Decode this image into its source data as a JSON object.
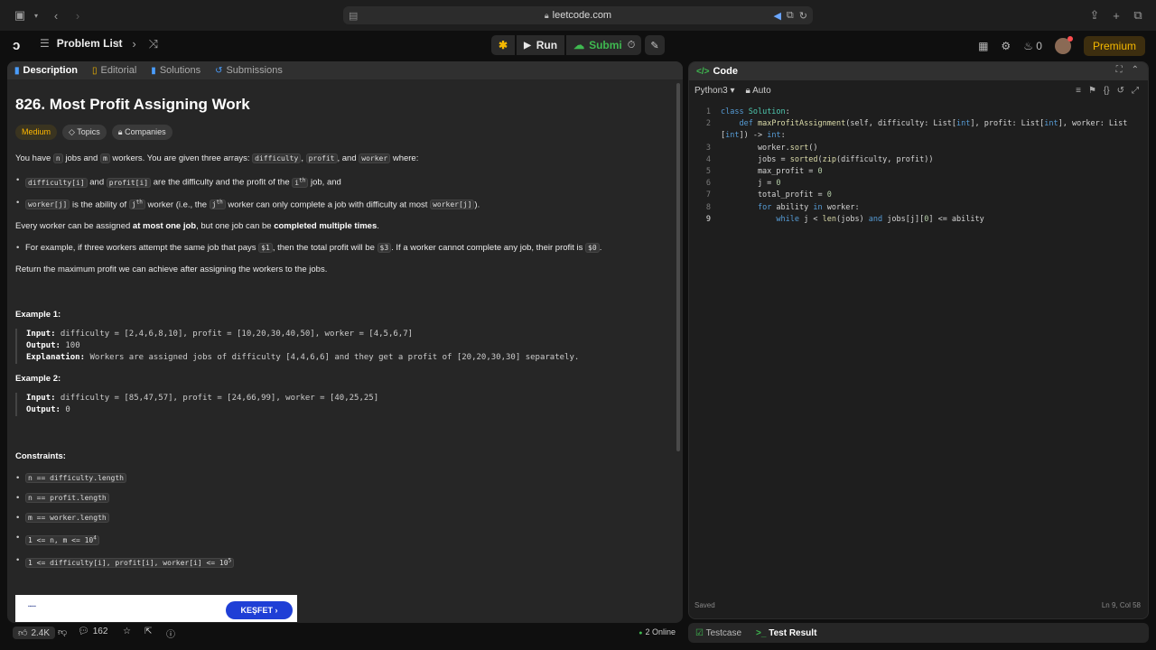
{
  "browser": {
    "url": "leetcode.com"
  },
  "nav": {
    "problem_list": "Problem List",
    "run": "Run",
    "submit": "Submit",
    "streak": "0",
    "premium": "Premium"
  },
  "left": {
    "tabs": [
      "Description",
      "Editorial",
      "Solutions",
      "Submissions"
    ],
    "title": "826. Most Profit Assigning Work",
    "pills": [
      "Medium",
      "Topics",
      "Companies"
    ],
    "intro": {
      "p1": "You have ",
      "c_n": "n",
      "p2": " jobs and ",
      "c_m": "m",
      "p3": " workers. You are given three arrays: ",
      "c_d": "difficulty",
      "c_p": "profit",
      "p4": ", and ",
      "c_w": "worker",
      "p5": " where:",
      "sep": ", "
    },
    "bullets1": {
      "c_di": "difficulty[i]",
      "and": " and ",
      "c_pi": "profit[i]",
      "text": " are the difficulty and the profit of the ",
      "i": "i",
      "th": "th",
      "job": " job, and"
    },
    "bullets2": {
      "c_wj": "worker[j]",
      "text1": " is the ability of ",
      "j": "j",
      "th": "th",
      "text2": " worker (i.e., the ",
      "text3": " worker can only complete a job with difficulty at most ",
      "end": ")."
    },
    "every": {
      "p1": "Every worker can be assigned ",
      "b1": "at most one job",
      "p2": ", but one job can be ",
      "b2": "completed multiple times",
      "p3": "."
    },
    "example_bullet": {
      "p1": "For example, if three workers attempt the same job that pays ",
      "c1": "$1",
      "p2": ", then the total profit will be ",
      "c2": "$3",
      "p3": ". If a worker cannot complete any job, their profit is ",
      "c3": "$0",
      "p4": "."
    },
    "return_text": "Return the maximum profit we can achieve after assigning the workers to the jobs.",
    "example1": {
      "title": "Example 1:",
      "input_label": "Input:",
      "input": " difficulty = [2,4,6,8,10], profit = [10,20,30,40,50], worker = [4,5,6,7]",
      "output_label": "Output:",
      "output": " 100",
      "expl_label": "Explanation:",
      "expl": " Workers are assigned jobs of difficulty [4,4,6,6] and they get a profit of [20,20,30,30] separately."
    },
    "example2": {
      "title": "Example 2:",
      "input_label": "Input:",
      "input": " difficulty = [85,47,57], profit = [24,66,99], worker = [40,25,25]",
      "output_label": "Output:",
      "output": " 0"
    },
    "constraints_title": "Constraints:",
    "constraints": {
      "c1": "n == difficulty.length",
      "c2": "n == profit.length",
      "c3": "m == worker.length",
      "c4": "1 <= n, m <= 10",
      "c4_sup": "4",
      "c5": "1 <= difficulty[i], profit[i], worker[i] <= 10",
      "c5_sup": "5"
    },
    "banner_button": "KEŞFET",
    "footer": {
      "likes": "2.4K",
      "comments": "162",
      "online": "2 Online"
    }
  },
  "right": {
    "code_tab": "Code",
    "language": "Python3",
    "auto": "Auto",
    "status": "Saved",
    "cursor": "Ln 9, Col 58",
    "footer_tabs": [
      "Testcase",
      "Test Result"
    ]
  }
}
